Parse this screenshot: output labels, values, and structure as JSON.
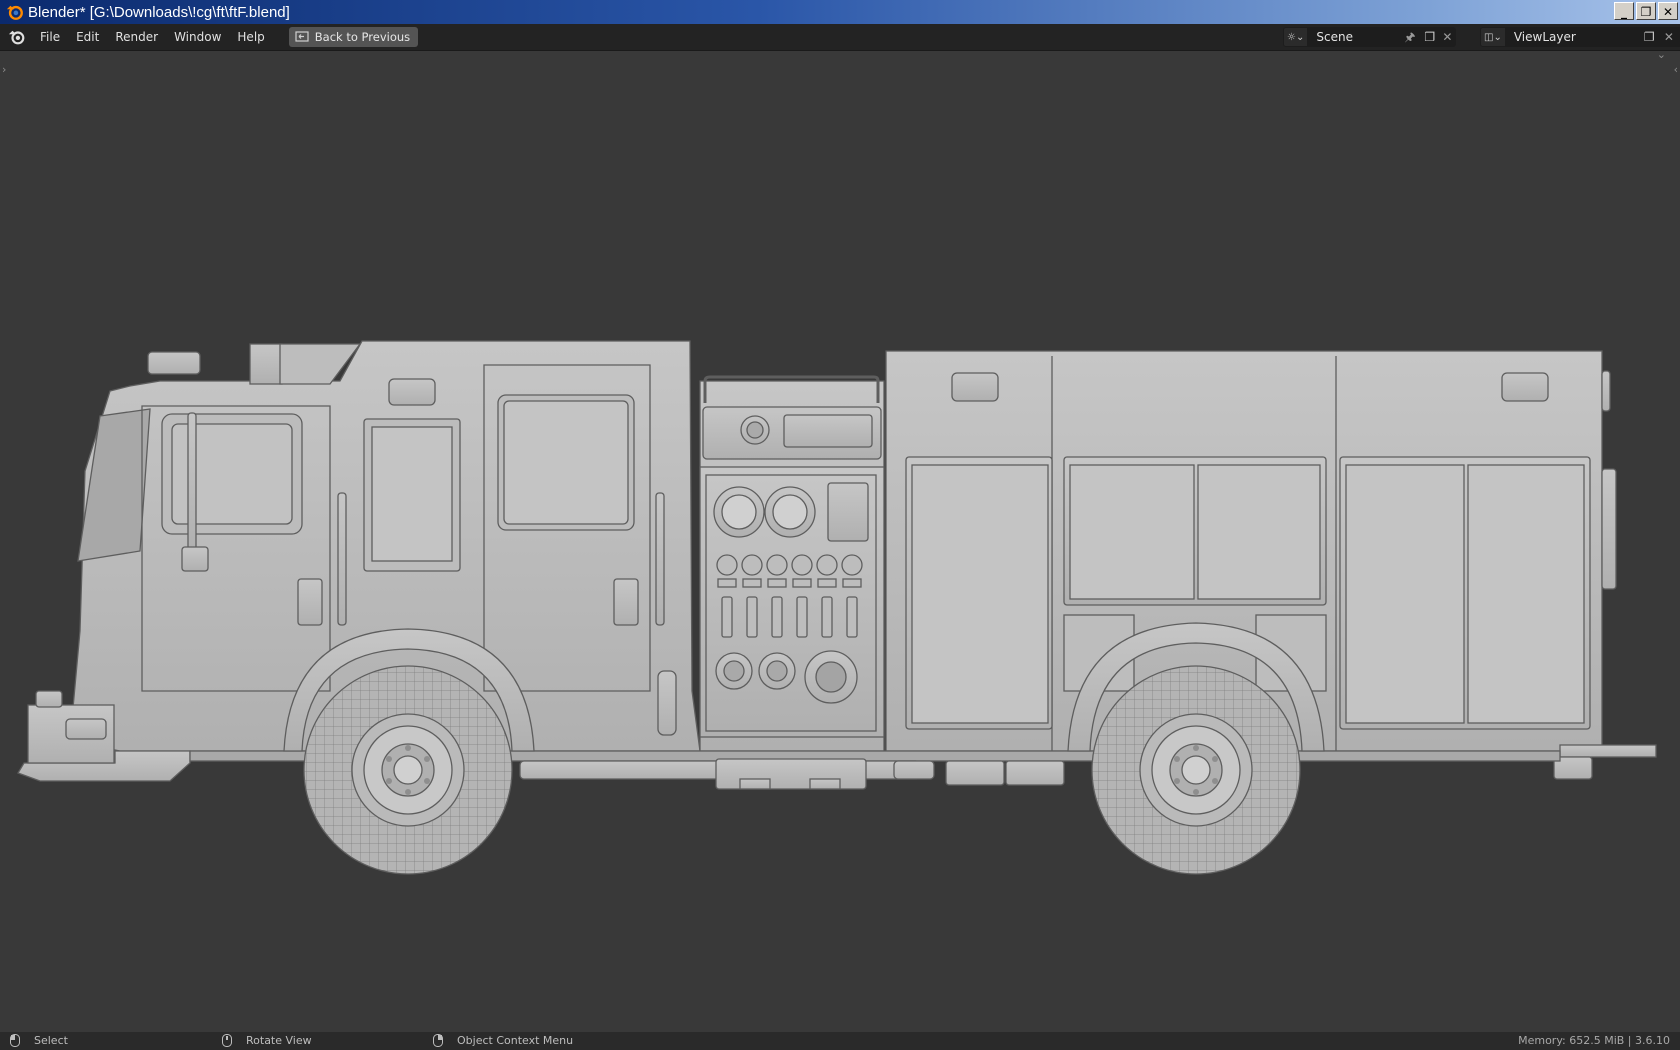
{
  "window": {
    "title": "Blender* [G:\\Downloads\\!cg\\ft\\ftF.blend]",
    "controls": [
      "minimize-icon",
      "restore-icon",
      "close-icon"
    ]
  },
  "topbar": {
    "menus": [
      "File",
      "Edit",
      "Render",
      "Window",
      "Help"
    ],
    "back_button": "Back to Previous",
    "scene": {
      "name": "Scene",
      "icons": [
        "scene-icon",
        "pin-icon",
        "new-scene-icon",
        "close-icon"
      ]
    },
    "view_layer": {
      "name": "ViewLayer",
      "icons": [
        "view-layer-icon",
        "new-layer-icon",
        "close-icon"
      ]
    }
  },
  "viewport": {
    "background": "#393939",
    "content": "fire-truck-model-side-view"
  },
  "statusbar": {
    "hints": [
      {
        "icon": "mouse-left-icon",
        "label": "Select"
      },
      {
        "icon": "mouse-middle-icon",
        "label": "Rotate View"
      },
      {
        "icon": "mouse-right-icon",
        "label": "Object Context Menu"
      }
    ],
    "memory": "Memory: 652.5 MiB | 3.6.10"
  }
}
